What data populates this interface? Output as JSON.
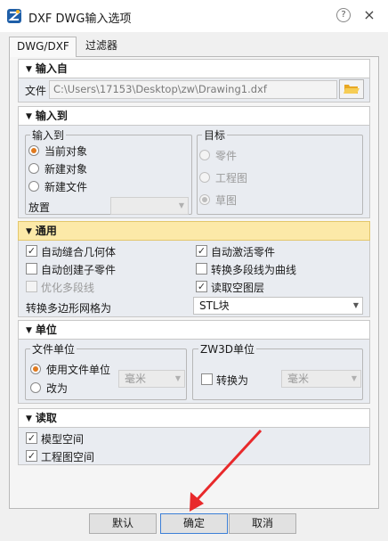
{
  "window": {
    "title": "DXF DWG输入选项",
    "help": "?",
    "close": "×"
  },
  "tabs": [
    {
      "label": "DWG/DXF",
      "active": true
    },
    {
      "label": "过滤器",
      "active": false
    }
  ],
  "sections": {
    "input_from": {
      "title": "输入自",
      "file_label": "文件",
      "file_path": "C:\\Users\\17153\\Desktop\\zw\\Drawing1.dxf"
    },
    "input_to": {
      "title": "输入到",
      "group_input": {
        "title": "输入到",
        "options": [
          {
            "label": "当前对象",
            "selected": true
          },
          {
            "label": "新建对象",
            "selected": false
          },
          {
            "label": "新建文件",
            "selected": false
          }
        ],
        "place_label": "放置",
        "place_value": ""
      },
      "group_target": {
        "title": "目标",
        "options": [
          {
            "label": "零件",
            "selected": false
          },
          {
            "label": "工程图",
            "selected": false
          },
          {
            "label": "草图",
            "selected": true
          }
        ]
      }
    },
    "general": {
      "title": "通用",
      "checks": [
        {
          "label": "自动缝合几何体",
          "checked": true,
          "enabled": true
        },
        {
          "label": "自动激活零件",
          "checked": true,
          "enabled": true
        },
        {
          "label": "自动创建子零件",
          "checked": false,
          "enabled": true
        },
        {
          "label": "转换多段线为曲线",
          "checked": false,
          "enabled": true
        },
        {
          "label": "优化多段线",
          "checked": false,
          "enabled": false
        },
        {
          "label": "读取空图层",
          "checked": true,
          "enabled": true
        }
      ],
      "mesh_label": "转换多边形网格为",
      "mesh_value": "STL块"
    },
    "units": {
      "title": "单位",
      "file_unit": {
        "title": "文件单位",
        "options": [
          {
            "label": "使用文件单位",
            "selected": true
          },
          {
            "label": "改为",
            "selected": false
          }
        ],
        "unit_value": "毫米"
      },
      "zw3d_unit": {
        "title": "ZW3D单位",
        "convert_label": "转换为",
        "convert_checked": false,
        "unit_value": "毫米"
      }
    },
    "read": {
      "title": "读取",
      "checks": [
        {
          "label": "模型空间",
          "checked": true
        },
        {
          "label": "工程图空间",
          "checked": true
        }
      ]
    }
  },
  "buttons": {
    "default": "默认",
    "ok": "确定",
    "cancel": "取消"
  },
  "colors": {
    "accent_orange": "#e07a1f",
    "highlight_header": "#fce9a8",
    "annotation_arrow": "#e8292b"
  },
  "icons": {
    "logo": "zw3d-logo-icon",
    "folder": "folder-open-icon"
  }
}
